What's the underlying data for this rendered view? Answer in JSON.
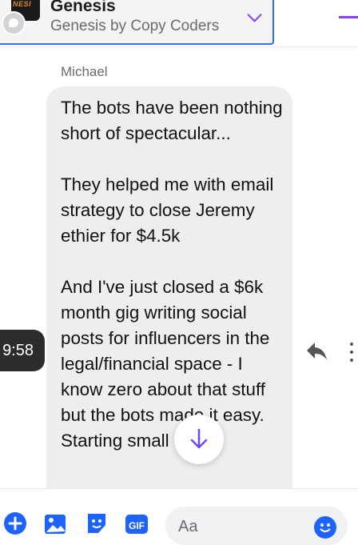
{
  "header": {
    "title": "Genesis",
    "subtitle": "Genesis by Copy Coders",
    "avatar_text": "NESI",
    "accent": "#8a3dff",
    "focus_border": "#2f6bff"
  },
  "message": {
    "sender": "Michael",
    "time": "9:58",
    "text": "The bots have been nothing short of spectacular...\n\nThey helped me with email strategy to close Jeremy ethier for $4.5k\n\nAnd I've just closed a $6k month gig writing social posts for influencers in the legal/financial space - I know zero about that stuff but the bots made it easy. Starting small"
  },
  "composer": {
    "placeholder": "Aa",
    "icons": [
      "plus-icon",
      "image-icon",
      "sticker-icon",
      "gif-icon",
      "emoji-icon"
    ],
    "icon_color": "#1e63ff"
  }
}
